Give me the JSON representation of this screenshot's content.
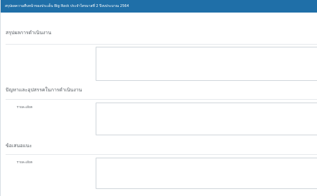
{
  "header": {
    "title": "สรุปผลความคืบหน้าของประเด็น Big Rock ประจำไตรมาสที่ 2 ปีงบประมาณ 2564"
  },
  "sections": [
    {
      "title": "สรุปผลการดำเนินงาน",
      "field_label": "",
      "field_value": ""
    },
    {
      "title": "ปัญหาและอุปสรรคในการดำเนินงาน",
      "field_label": "รายละเอียด",
      "field_value": ""
    },
    {
      "title": "ข้อเสนอแนะ",
      "field_label": "รายละเอียด",
      "field_value": ""
    }
  ],
  "colors": {
    "header_bg": "#1f6fa8",
    "header_text": "#ffffff",
    "field_border": "#cfd5da"
  }
}
